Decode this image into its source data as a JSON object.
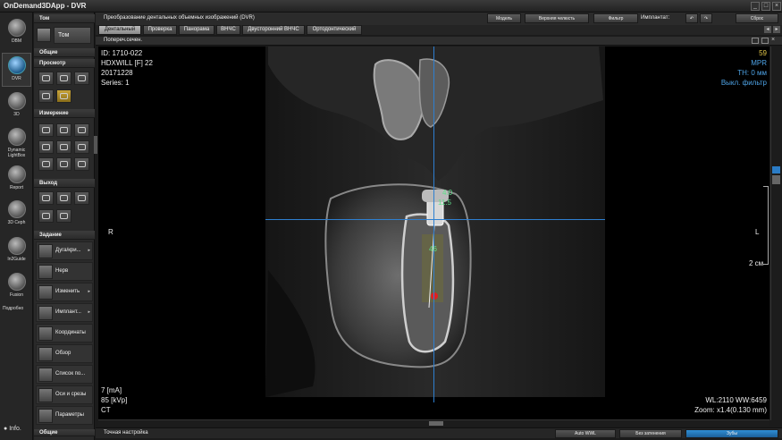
{
  "window": {
    "title": "OnDemand3DApp - DVR",
    "min": "_",
    "max": "□",
    "close": "×"
  },
  "leftnav": [
    {
      "name": "nav-dbm",
      "label": "DBM",
      "active": false
    },
    {
      "name": "nav-dvr",
      "label": "DVR",
      "active": true
    },
    {
      "name": "nav-3d",
      "label": "3D",
      "active": false
    },
    {
      "name": "nav-dynamic-lightbox",
      "label": "Dynamic LightBox",
      "active": false
    },
    {
      "name": "nav-report",
      "label": "Report",
      "active": false
    },
    {
      "name": "nav-3d-ceph",
      "label": "3D Ceph",
      "active": false
    },
    {
      "name": "nav-in2guide",
      "label": "In2Guide",
      "active": false
    },
    {
      "name": "nav-fusion",
      "label": "Fusion",
      "active": false
    }
  ],
  "leftnav_more": "Подробно",
  "leftnav_info": "Info.",
  "toolpanel": {
    "tom_header": "Том",
    "tom_button": "Том",
    "general_header": "Общие",
    "view_header": "Просмотр",
    "measure_header": "Измерение",
    "output_header": "Выход",
    "task_header": "Задание",
    "tasks": [
      {
        "label": "Дуга/кри...",
        "arrow": "▸"
      },
      {
        "label": "Нерв",
        "arrow": ""
      },
      {
        "label": "Изменить",
        "arrow": "▸"
      },
      {
        "label": "Имплант...",
        "arrow": "▸"
      },
      {
        "label": "Координаты",
        "arrow": ""
      },
      {
        "label": "Обзор",
        "arrow": ""
      },
      {
        "label": "Список по...",
        "arrow": ""
      },
      {
        "label": "Оси и срезы",
        "arrow": ""
      },
      {
        "label": "Параметры",
        "arrow": ""
      }
    ],
    "more_header": "Общие"
  },
  "mainhdr": {
    "title": "Преобразование дентальных объемных изображений (DVR)",
    "btn_model": "Модель",
    "btn_upper": "Верхняя челюсть",
    "btn_filter": "Фильтр",
    "implant_label": "Имплантат:",
    "btn_reset": "Сброс"
  },
  "tabs": [
    "Дентальный",
    "Проверка",
    "Панорама",
    "ВНЧС",
    "Двусторонний ВНЧС",
    "Ортодонтический"
  ],
  "viewhdr": {
    "title": "Попереч.сечен."
  },
  "overlay": {
    "id": "ID: 1710-022",
    "patient": "HDXWILL [F] 22",
    "date": "20171228",
    "series": "Series: 1",
    "slice": "59",
    "mode": "MPR",
    "th": "TH: 0 мм",
    "filter": "Выкл. фильтр",
    "left_marker": "R",
    "right_marker": "L",
    "scale": "2 см",
    "ma": "7 [mA]",
    "kvp": "85 [kVp]",
    "modality": "CT",
    "wl": "WL:2110 WW:6459",
    "zoom": "Zoom: x1.4(0.130 mm)",
    "implant_top": "4.0",
    "implant_len": "11.5",
    "implant_mid": "46"
  },
  "bottombar": {
    "title": "Точная настройка",
    "btn_auto": "Auto WWL",
    "btn_noshade": "Без затенения",
    "btn_teeth": "Зубы"
  },
  "colors": {
    "accent": "#2f8fd6",
    "overlay_blue": "#4ea3e6",
    "slice_yellow": "#e3c74a",
    "implant_green": "#5fe08a"
  }
}
